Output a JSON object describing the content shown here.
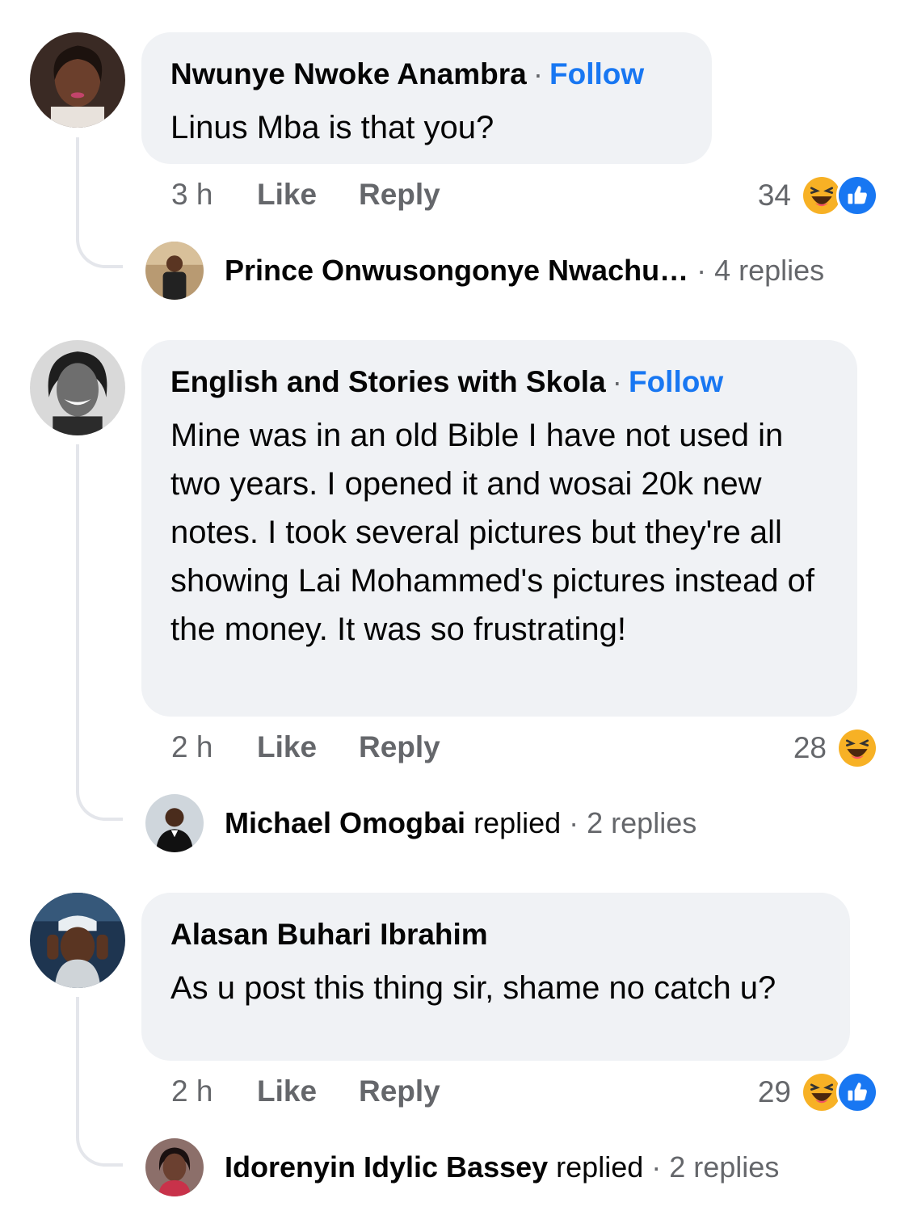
{
  "comments": [
    {
      "author": "Nwunye Nwoke Anambra",
      "follow_label": "Follow",
      "text": "Linus Mba is that you?",
      "time": "3 h",
      "like_label": "Like",
      "reply_label": "Reply",
      "reaction_count": "34",
      "reactions": [
        "haha-icon",
        "like-icon"
      ],
      "reply_preview": {
        "name": "Prince Onwusongonye Nwachu…",
        "verb": "",
        "count": "4 replies"
      }
    },
    {
      "author": "English and Stories with Skola",
      "follow_label": "Follow",
      "text": "Mine was in an old Bible I have not used in two years. I opened it and wosai 20k new notes. I took several pictures but they're all showing Lai Mohammed's pictures instead of the money. It was so frustrating!",
      "time": "2 h",
      "like_label": "Like",
      "reply_label": "Reply",
      "reaction_count": "28",
      "reactions": [
        "haha-icon"
      ],
      "reply_preview": {
        "name": "Michael Omogbai",
        "verb": "replied",
        "count": "2 replies"
      }
    },
    {
      "author": "Alasan Buhari Ibrahim",
      "follow_label": "",
      "text": "As u post this thing sir, shame no catch u?",
      "time": "2 h",
      "like_label": "Like",
      "reply_label": "Reply",
      "reaction_count": "29",
      "reactions": [
        "haha-icon",
        "like-icon"
      ],
      "reply_preview": {
        "name": "Idorenyin Idylic Bassey",
        "verb": "replied",
        "count": "2 replies"
      }
    }
  ],
  "colors": {
    "bubble": "#f0f2f5",
    "follow": "#1877f2",
    "meta": "#65676b",
    "haha": "#f7b125",
    "like": "#1877f2"
  }
}
